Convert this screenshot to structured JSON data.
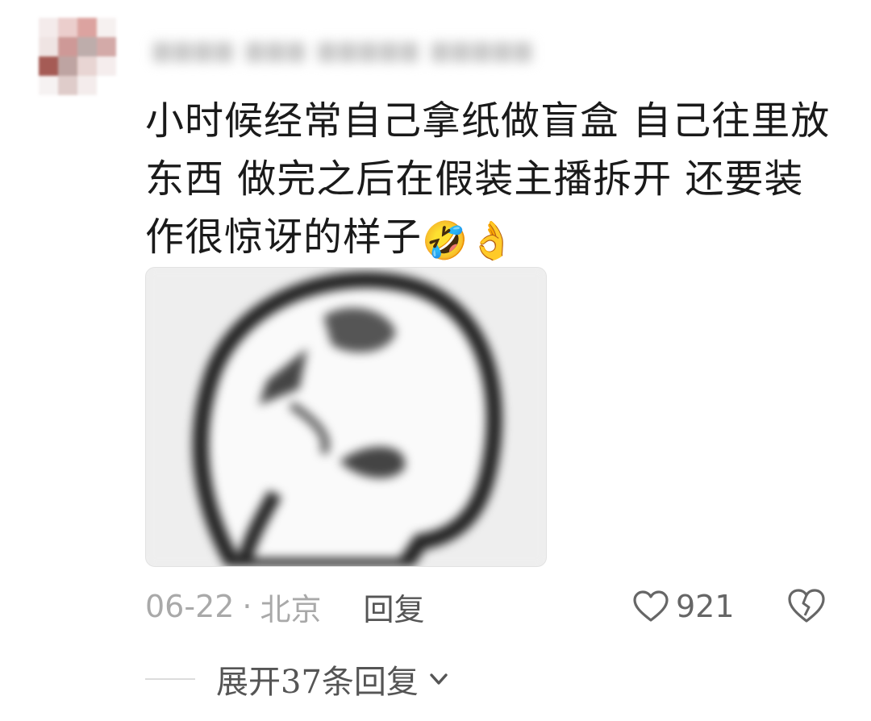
{
  "comment": {
    "text": "小时候经常自己拿纸做盲盒 自己往里放东西 做完之后在假装主播拆开 还要装作很惊讶的样子",
    "emojis": [
      "🤣",
      "👌"
    ],
    "date": "06-22",
    "separator": "·",
    "location": "北京",
    "reply_label": "回复",
    "like_count": "921",
    "expand_label": "展开37条回复"
  },
  "icons": {
    "like": "heart-outline-icon",
    "dislike": "broken-heart-icon",
    "expand": "chevron-down-icon"
  },
  "colors": {
    "text": "#1a1a1a",
    "meta": "#a9a9a9",
    "secondary": "#555555"
  }
}
